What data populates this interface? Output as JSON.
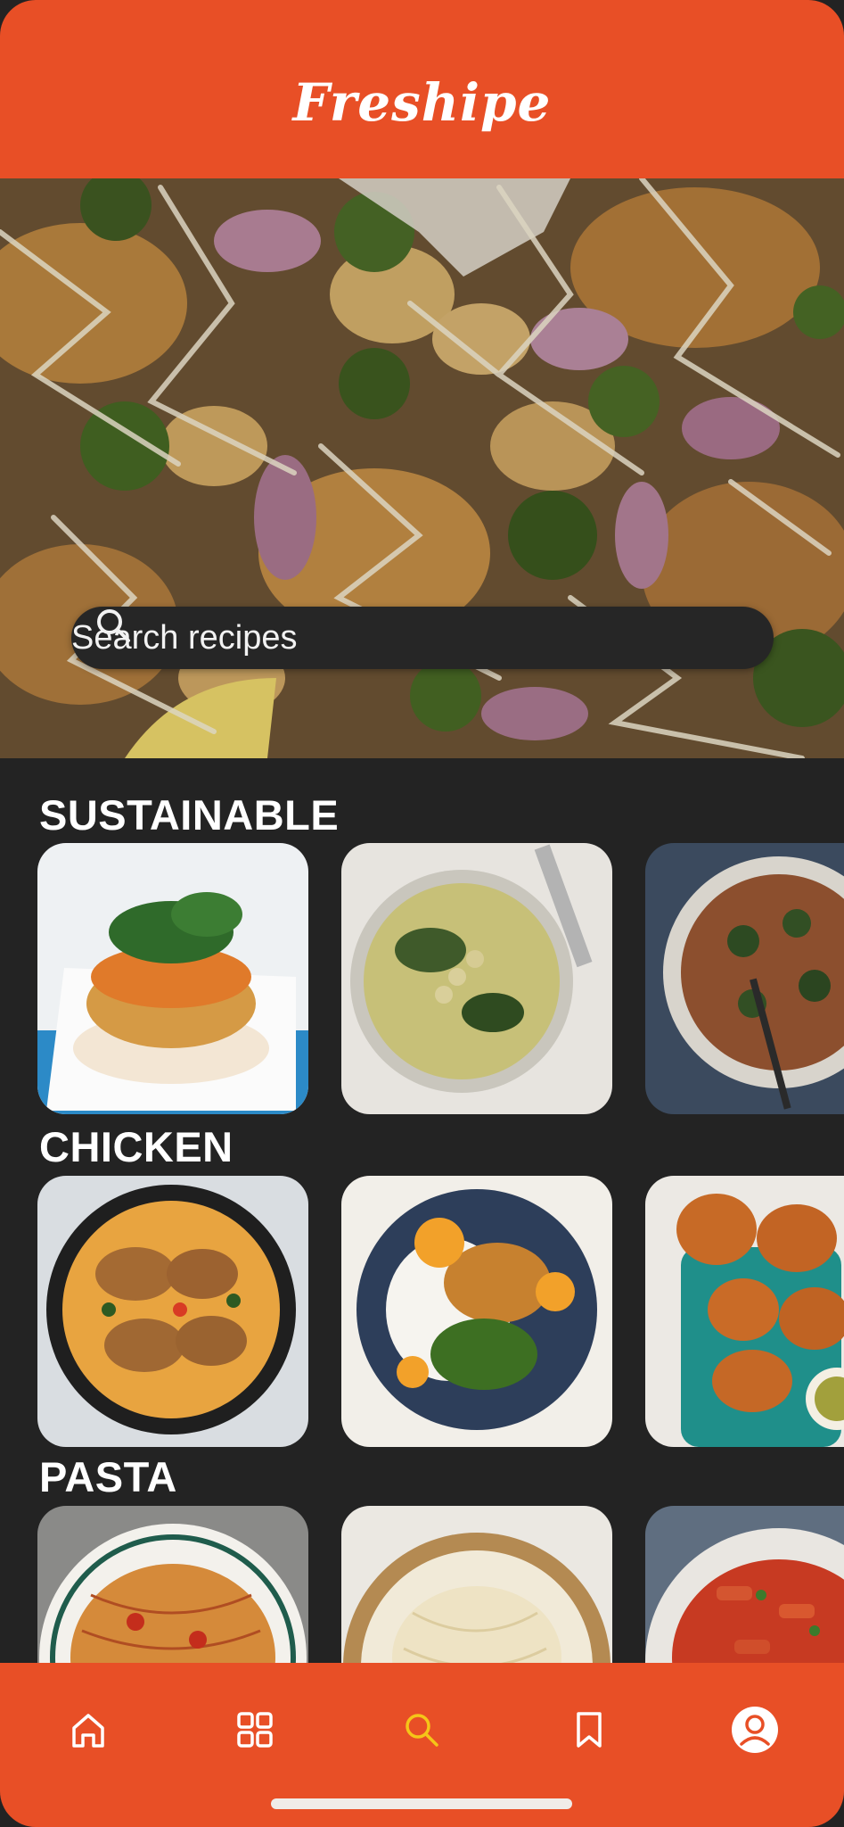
{
  "app": {
    "title": "Freshipe"
  },
  "search": {
    "placeholder": "Search recipes",
    "icon": "search-icon"
  },
  "sections": [
    {
      "title": "SUSTAINABLE"
    },
    {
      "title": "CHICKEN"
    },
    {
      "title": "PASTA"
    }
  ],
  "tabbar": {
    "items": [
      {
        "icon": "home-icon"
      },
      {
        "icon": "grid-icon"
      },
      {
        "icon": "search-icon",
        "active": true
      },
      {
        "icon": "bookmark-icon"
      },
      {
        "icon": "profile-icon"
      }
    ],
    "active_color": "#f5c518",
    "inactive_color": "#ffffff"
  },
  "colors": {
    "brand": "#e84f26",
    "background": "#232323",
    "search_bg": "#262626"
  }
}
